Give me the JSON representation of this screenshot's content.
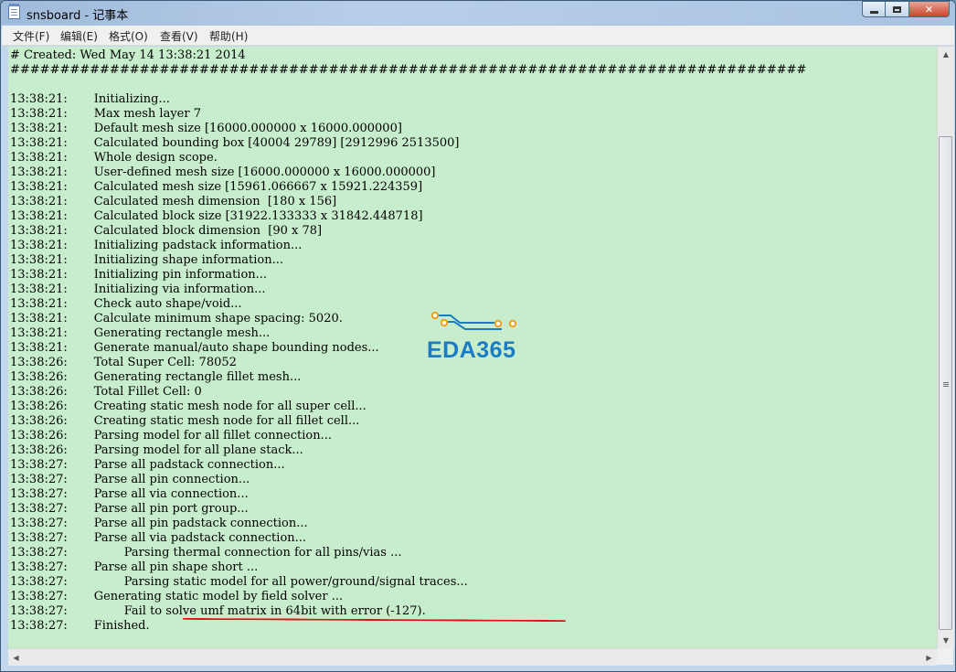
{
  "window": {
    "title": "snsboard - 记事本"
  },
  "menubar": {
    "items": [
      "文件(F)",
      "编辑(E)",
      "格式(O)",
      "查看(V)",
      "帮助(H)"
    ]
  },
  "editor": {
    "background_color": "#c7edcc",
    "lines": [
      "# Created: Wed May 14 13:38:21 2014",
      "################################################################################",
      "",
      "13:38:21:\tInitializing...",
      "13:38:21:\tMax mesh layer 7",
      "13:38:21:\tDefault mesh size [16000.000000 x 16000.000000]",
      "13:38:21:\tCalculated bounding box [40004 29789] [2912996 2513500]",
      "13:38:21:\tWhole design scope.",
      "13:38:21:\tUser-defined mesh size [16000.000000 x 16000.000000]",
      "13:38:21:\tCalculated mesh size [15961.066667 x 15921.224359]",
      "13:38:21:\tCalculated mesh dimension  [180 x 156]",
      "13:38:21:\tCalculated block size [31922.133333 x 31842.448718]",
      "13:38:21:\tCalculated block dimension  [90 x 78]",
      "13:38:21:\tInitializing padstack information...",
      "13:38:21:\tInitializing shape information...",
      "13:38:21:\tInitializing pin information...",
      "13:38:21:\tInitializing via information...",
      "13:38:21:\tCheck auto shape/void...",
      "13:38:21:\tCalculate minimum shape spacing: 5020.",
      "13:38:21:\tGenerating rectangle mesh...",
      "13:38:21:\tGenerate manual/auto shape bounding nodes...",
      "13:38:26:\tTotal Super Cell: 78052",
      "13:38:26:\tGenerating rectangle fillet mesh...",
      "13:38:26:\tTotal Fillet Cell: 0",
      "13:38:26:\tCreating static mesh node for all super cell...",
      "13:38:26:\tCreating static mesh node for all fillet cell...",
      "13:38:26:\tParsing model for all fillet connection...",
      "13:38:26:\tParsing model for all plane stack...",
      "13:38:27:\tParse all padstack connection...",
      "13:38:27:\tParse all pin connection...",
      "13:38:27:\tParse all via connection...",
      "13:38:27:\tParse all pin port group...",
      "13:38:27:\tParse all pin padstack connection...",
      "13:38:27:\tParse all via padstack connection...",
      "13:38:27:\t\tParsing thermal connection for all pins/vias ...",
      "13:38:27:\tParse all pin shape short ...",
      "13:38:27:\t\tParsing static model for all power/ground/signal traces...",
      "13:38:27:\tGenerating static model by field solver ...",
      "13:38:27:\t\tFail to solve umf matrix in 64bit with error (-127).",
      "13:38:27:\tFinished."
    ]
  },
  "annotation": {
    "underline_color": "#e01010"
  },
  "watermark": {
    "text": "EDA365",
    "color": "#1b7bc4",
    "accent_color": "#f0a020"
  },
  "icons": {
    "app": "notepad-icon",
    "minimize": "minimize-icon",
    "maximize": "maximize-icon",
    "close": "close-icon"
  }
}
